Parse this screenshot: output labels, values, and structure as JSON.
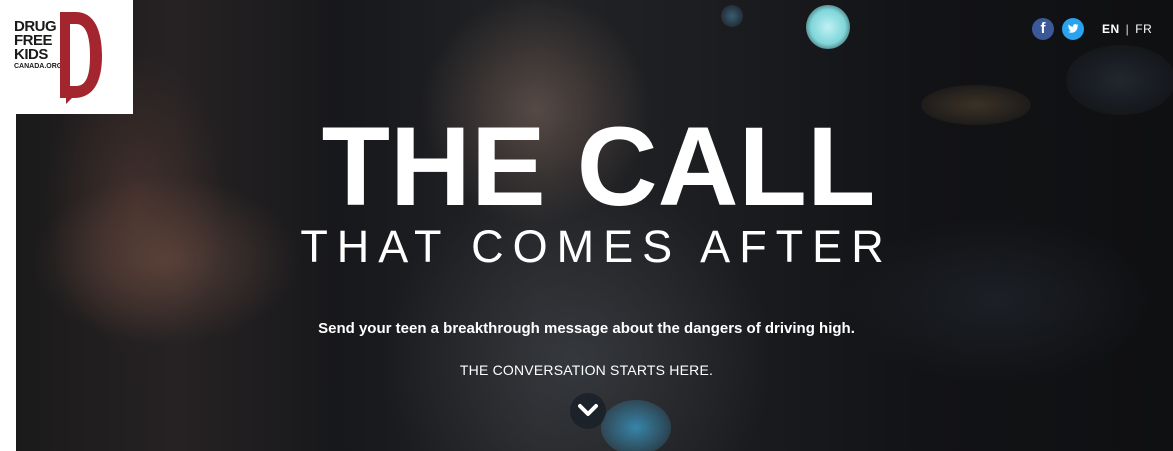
{
  "logo": {
    "lines": [
      "DRUG",
      "FREE",
      "KIDS",
      "CANADA.ORG"
    ],
    "brand_color": "#a3262e"
  },
  "social": {
    "facebook_icon": "f",
    "twitter_icon": "twitter-bird",
    "facebook_color": "#3b5998",
    "twitter_color": "#2aa3ef"
  },
  "language": {
    "active": "EN",
    "separator": "|",
    "other": "FR"
  },
  "hero": {
    "title": "THE CALL",
    "subtitle": "THAT COMES AFTER",
    "tagline": "Send your teen a breakthrough message about the dangers of driving high.",
    "cta": "THE CONVERSATION STARTS HERE."
  }
}
